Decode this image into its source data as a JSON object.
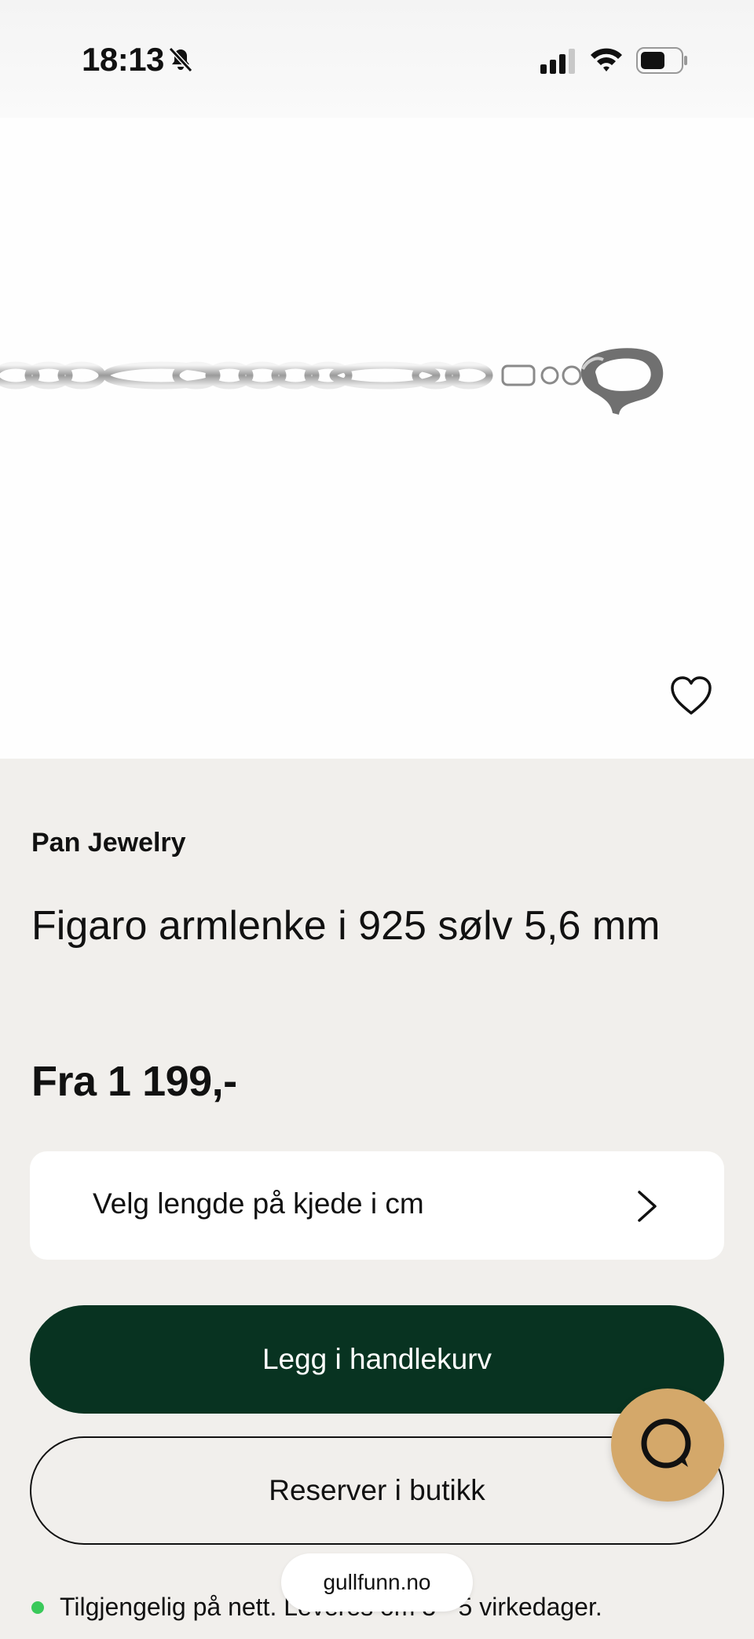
{
  "status_bar": {
    "time": "18:13",
    "icons": [
      "bell-slash-icon",
      "signal-icon",
      "wifi-icon",
      "battery-icon"
    ]
  },
  "product": {
    "image_alt": "figaro-chain-bracelet",
    "brand": "Pan Jewelry",
    "title": "Figaro armlenke i 925 sølv 5,6 mm",
    "price": "Fra 1 199,-",
    "favorite_icon": "heart-icon"
  },
  "length_selector": {
    "label": "Velg lengde på kjede i cm",
    "icon": "chevron-right-icon"
  },
  "actions": {
    "add_to_cart": "Legg i handlekurv",
    "reserve": "Reserver i butikk"
  },
  "availability": {
    "text": "Tilgjengelig på nett. Leveres om 3 - 5 virkedager.",
    "status_color": "#3ac95a"
  },
  "browser": {
    "url": "gullfunn.no"
  },
  "chat": {
    "icon": "chat-bubble-icon",
    "color": "#d4a86a"
  },
  "theme": {
    "primary": "#083321",
    "background": "#f1efec"
  }
}
